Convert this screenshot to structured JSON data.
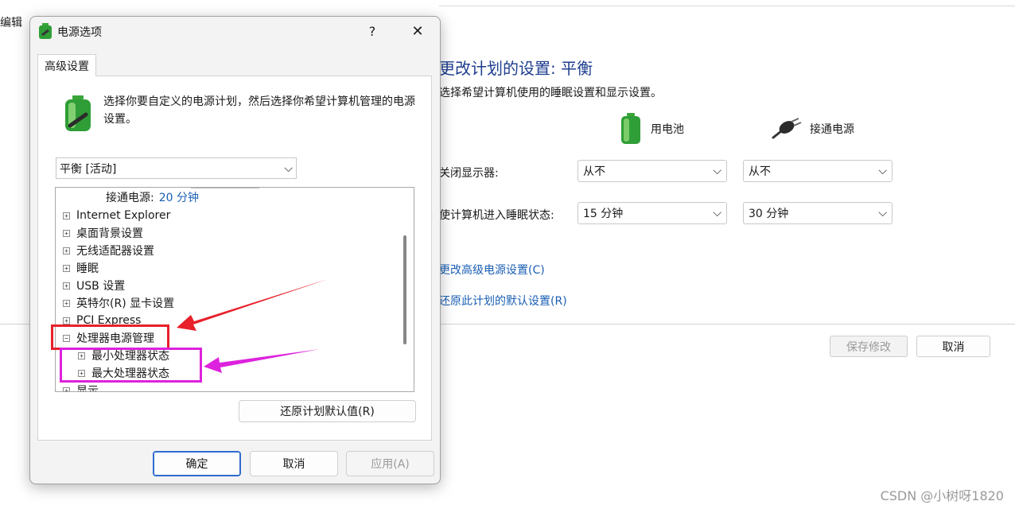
{
  "background": {
    "menu_text": "编辑",
    "title": "更改计划的设置: 平衡",
    "subtitle": "选择希望计算机使用的睡眠设置和显示设置。",
    "col_battery": "用电池",
    "col_plugged": "接通电源",
    "rows": [
      {
        "label": "关闭显示器:",
        "battery": "从不",
        "plugged": "从不"
      },
      {
        "label": "使计算机进入睡眠状态:",
        "battery": "15 分钟",
        "plugged": "30 分钟"
      }
    ],
    "link_advanced": "更改高级电源设置(C)",
    "link_restore": "还原此计划的默认设置(R)",
    "save_button": "保存修改",
    "cancel_button": "取消"
  },
  "dialog": {
    "title": "电源选项",
    "help": "?",
    "close": "✕",
    "tab": "高级设置",
    "info": "选择你要自定义的电源计划，然后选择你希望计算机管理的电源设置。",
    "plan": "平衡 [活动]",
    "tree": {
      "sub_label": "接通电源:",
      "sub_value": "20 分钟",
      "items": [
        "Internet Explorer",
        "桌面背景设置",
        "无线适配器设置",
        "睡眠",
        "USB 设置",
        "英特尔(R) 显卡设置",
        "PCI Express",
        "处理器电源管理"
      ],
      "children": [
        "最小处理器状态",
        "最大处理器状态"
      ],
      "last": "显示"
    },
    "restore_button": "还原计划默认值(R)",
    "ok_button": "确定",
    "cancel_button": "取消",
    "apply_button": "应用(A)"
  },
  "colors": {
    "annotation_red": "#e8202a",
    "annotation_magenta": "#dd22dd",
    "link": "#1a5fb4",
    "title": "#1e3e8f"
  },
  "watermark": "CSDN @小树呀1820"
}
